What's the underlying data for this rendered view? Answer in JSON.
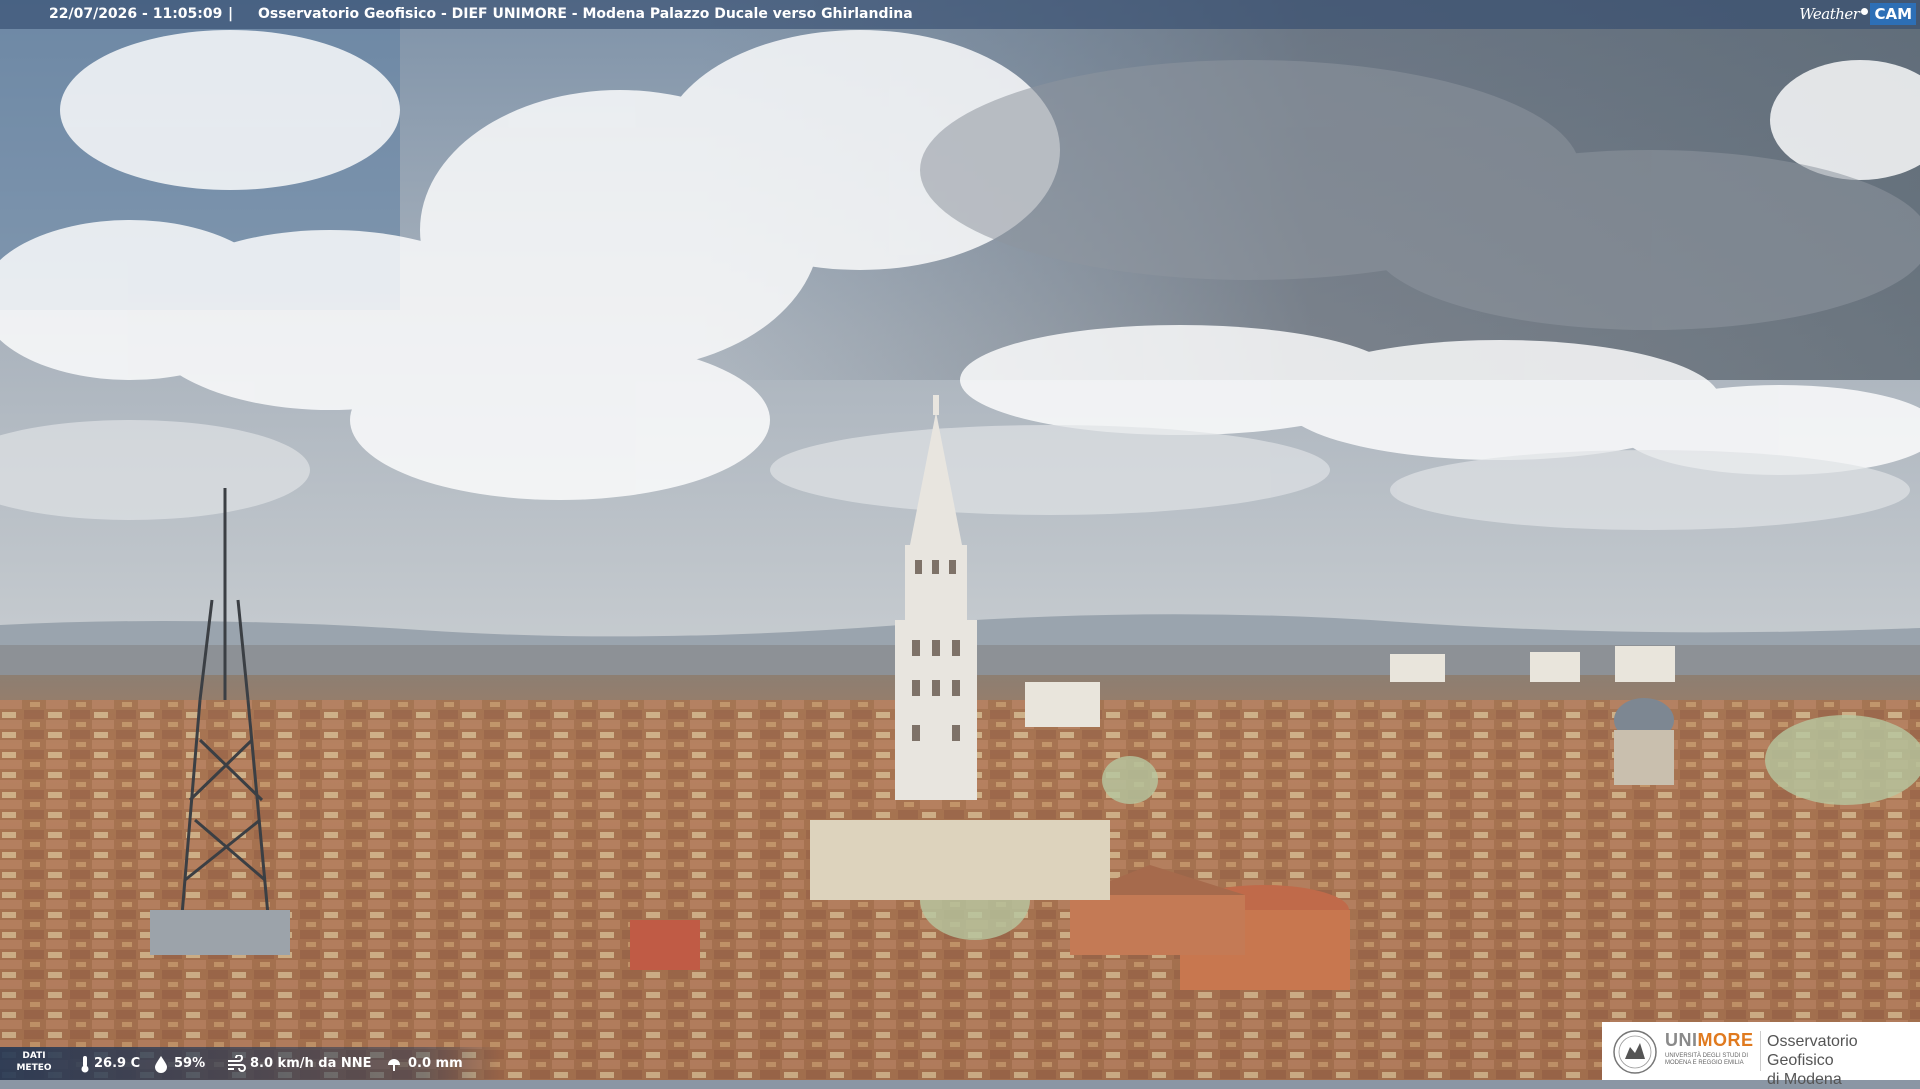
{
  "header": {
    "timestamp": "22/07/2026 - 11:05:09",
    "separator": "|",
    "title": "Osservatorio Geofisico - DIEF UNIMORE - Modena Palazzo Ducale verso Ghirlandina"
  },
  "brand": {
    "weather": "Weather",
    "cam": "CAM",
    "accent": "#2d6fb6"
  },
  "meteo": {
    "label_line1": "DATI",
    "label_line2": "METEO",
    "temperature": "26.9 C",
    "humidity": "59%",
    "wind": "8.0 km/h da NNE",
    "rain": "0.0 mm"
  },
  "logo": {
    "uni": "UNI",
    "more": "MORE",
    "subtitle": "UNIVERSITÀ DEGLI STUDI DI MODENA E REGGIO EMILIA",
    "observatory_line1": "Osservatorio Geofisico",
    "observatory_line2": "di Modena",
    "accent": "#e07a1f"
  },
  "icons": [
    "thermometer-icon",
    "humidity-drop-icon",
    "wind-icon",
    "rain-icon",
    "unimore-seal-icon"
  ]
}
